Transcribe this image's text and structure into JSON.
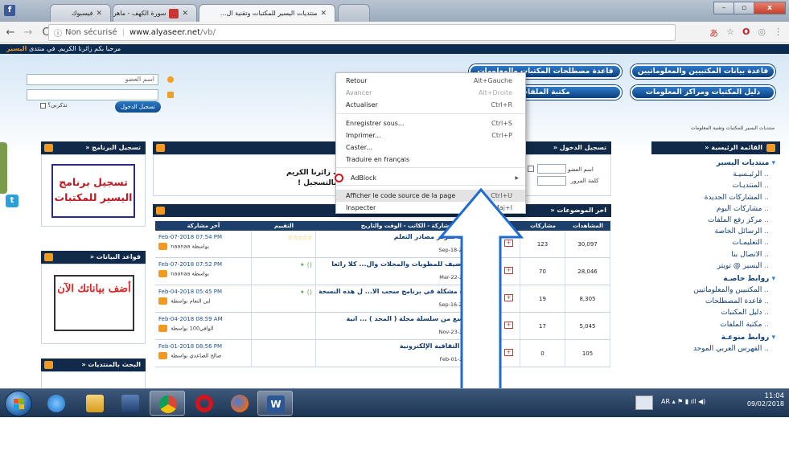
{
  "browser": {
    "tabs": [
      {
        "label": "منتديات اليسير للمكتبات وتقنية ال...",
        "active": true
      },
      {
        "label": "سورة الكهف - ماهر المعيقلي",
        "active": false
      },
      {
        "label": "فيسبوك",
        "active": false
      }
    ],
    "window_controls": [
      "–",
      "▫",
      "x"
    ],
    "security_label": "Non sécurisé",
    "url_host": "www.alyaseer.net",
    "url_path": "/vb/",
    "back": "←",
    "forward": "→",
    "reload": "C",
    "info": "ⓘ"
  },
  "page": {
    "welcome_strip": "مرحبا بكم زائرنا الكريم. في منتدى",
    "welcome_brand": "اليسير",
    "login": {
      "username_placeholder": "اسم العضو",
      "remember_label": "تذكرني؟",
      "login_button": "تسجيل الدخول"
    },
    "nav_buttons": [
      "قاعدة بيانات المكتبيين والمعلوماتيين",
      "قاعدة مصطلحات المكتبات والمعلومات",
      "دليل المكتبات ومراكز المعلومات",
      "مكتبة الملفات"
    ],
    "breadcrumb": "منتديات اليسير للمكتبات وتقنية المعلومات",
    "panels": {
      "program_registration": "تسجيل البرنامج",
      "databases": "قواعد البيانات",
      "forum_search": "البحث بالمنتديات",
      "login_panel": "تسجيل الدخول",
      "latest_topics": "اخر الموضوعات",
      "main_menu": "القائمة الرئيسية"
    },
    "promo_register": "تسجيل برنامج اليسير للمكتبات",
    "promo_add_data": "أضف بياناتك الآن",
    "login_panel_fields": {
      "username_label": "اسم العضو",
      "password_label": "كلمة المرور"
    },
    "welcome_message_1": "ك زائرنا الكريم",
    "welcome_message_2": "بالتسجيل !",
    "sidebar_items": [
      {
        "label": "منتديات اليسير",
        "type": "group"
      },
      {
        "label": "الرئيـسيـة",
        "type": "sub"
      },
      {
        "label": "المنتديـات",
        "type": "sub"
      },
      {
        "label": "المشاركات الجديدة",
        "type": "sub"
      },
      {
        "label": "مشاركات اليوم",
        "type": "sub"
      },
      {
        "label": "مركز رفع الملفات",
        "type": "sub"
      },
      {
        "label": "الرسائل الخاصة",
        "type": "sub"
      },
      {
        "label": "التعليمـات",
        "type": "sub"
      },
      {
        "label": "الاتصال بنا",
        "type": "sub"
      },
      {
        "label": "اليسير @ تويتر",
        "type": "sub"
      },
      {
        "label": "روابط خاصـة",
        "type": "group"
      },
      {
        "label": "المكتبيين والمعلوماتيين",
        "type": "sub"
      },
      {
        "label": "قاعدة المصطلحات",
        "type": "sub"
      },
      {
        "label": "دليل المكتبات",
        "type": "sub"
      },
      {
        "label": "مكتبة الملفات",
        "type": "sub"
      },
      {
        "label": "روابط منوعـة",
        "type": "group"
      },
      {
        "label": "الفهرس العربي الموحد",
        "type": "sub"
      }
    ],
    "table_headers": {
      "title": "عنوان المشاركة - الكاتب - الوقت والتاريخ",
      "rating": "التقييم",
      "last_post": "آخر مشاركة",
      "replies": "مشاركات",
      "views": "المشاهدات"
    },
    "threads": [
      {
        "title": "مجلة رائعة لمركز مصادر التعلم",
        "author": "عطاالله التركي",
        "date": "Sep-18-2006 12:29 AM",
        "rating": "☆☆☆☆☆",
        "last_date": "Feb-07-2018 07:54 PM",
        "last_by": "naanaa",
        "replies": "123",
        "views": "30,097"
      },
      {
        "title": "أبقونات تضيف للمطويات والمجلات وال... كلا رائعا",
        "author": "عطاالله التركي",
        "date": "Mar-22-2007 02:56 PM",
        "rating": "",
        "last_date": "Feb-07-2018 07:52 PM",
        "last_by": "naanaa",
        "replies": "70",
        "views": "28,046"
      },
      {
        "title": "الذي عنده مشكلة في برنامج سحب الا... ل هذه النسخة",
        "author": "صالح الصاعدي",
        "date": "Sep-16-2014 09:03 AM",
        "rating": "",
        "last_date": "Feb-04-2018 05:45 PM",
        "last_by": "لبن النعام",
        "replies": "19",
        "views": "8,305"
      },
      {
        "title": "العدد التاسع من سلسلة مجلة ( المجد ) ... انية",
        "author": "أبوفتان1",
        "date": "Nov-23-2007 08:47 PM",
        "rating": "",
        "last_date": "Feb-04-2018 08:59 AM",
        "last_by": "الوافي100",
        "replies": "17",
        "views": "5,045"
      },
      {
        "title": "المسابقة الثقافية الإلكترونية",
        "author": "صالح الصاعدي",
        "date": "Feb-01-2018 08:56 PM",
        "rating": "",
        "last_date": "Feb-01-2018 08:56 PM",
        "last_by": "صالح الصاعدي",
        "replies": "0",
        "views": "105"
      }
    ],
    "by_prefix": "بواسطة"
  },
  "context_menu": {
    "items": [
      {
        "label": "Retour",
        "shortcut": "Alt+Gauche",
        "disabled": false
      },
      {
        "label": "Avancer",
        "shortcut": "Alt+Droite",
        "disabled": true
      },
      {
        "label": "Actualiser",
        "shortcut": "Ctrl+R",
        "disabled": false
      },
      {
        "label": "Enregistrer sous...",
        "shortcut": "Ctrl+S",
        "disabled": false
      },
      {
        "label": "Imprimer...",
        "shortcut": "Ctrl+P",
        "disabled": false
      },
      {
        "label": "Caster...",
        "shortcut": "",
        "disabled": false
      },
      {
        "label": "Traduire en français",
        "shortcut": "",
        "disabled": false
      },
      {
        "label": "AdBlock",
        "shortcut": "",
        "disabled": false
      },
      {
        "label": "Afficher le code source de la page",
        "shortcut": "Ctrl+U",
        "disabled": false
      },
      {
        "label": "Inspecter",
        "shortcut": "Ctrl+Maj+I",
        "disabled": false
      }
    ]
  },
  "taskbar": {
    "time": "11:04",
    "date": "09/02/2018",
    "language": "AR"
  },
  "colors": {
    "nav_blue": "#0a3f7c",
    "header_dark": "#112a49",
    "accent_orange": "#f39a1e",
    "arrow_blue": "#1f6bd0"
  }
}
